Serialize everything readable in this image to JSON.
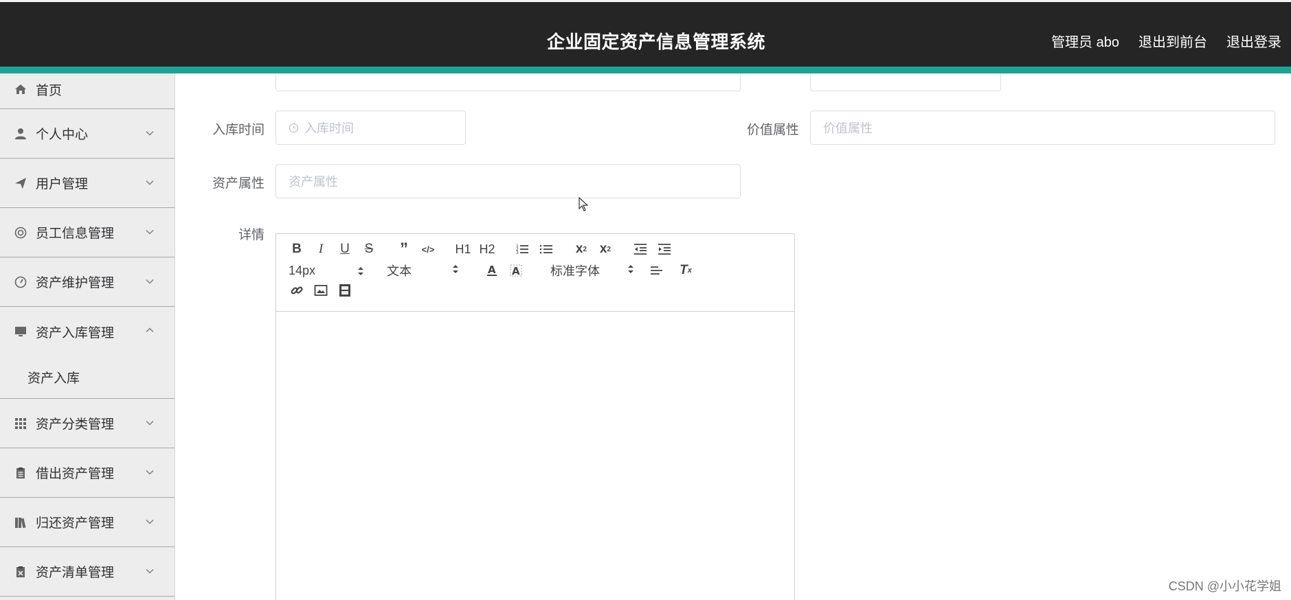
{
  "header": {
    "title": "企业固定资产信息管理系统",
    "user_label": "管理员 abo",
    "to_front_label": "退出到前台",
    "logout_label": "退出登录",
    "bg_color": "#252525",
    "accent_color": "#1aa497"
  },
  "sidebar": {
    "items": [
      {
        "label": "首页",
        "icon": "home-icon"
      },
      {
        "label": "个人中心",
        "icon": "person-icon"
      },
      {
        "label": "用户管理",
        "icon": "paper-plane-icon"
      },
      {
        "label": "员工信息管理",
        "icon": "lifebuoy-icon"
      },
      {
        "label": "资产维护管理",
        "icon": "gauge-icon"
      },
      {
        "label": "资产入库管理",
        "icon": "monitor-icon",
        "expanded": true,
        "children": [
          "资产入库"
        ]
      },
      {
        "label": "资产分类管理",
        "icon": "grid-icon"
      },
      {
        "label": "借出资产管理",
        "icon": "clipboard-icon"
      },
      {
        "label": "归还资产管理",
        "icon": "books-icon"
      },
      {
        "label": "资产清单管理",
        "icon": "clipboard-x-icon"
      }
    ]
  },
  "form": {
    "storage_time": {
      "label": "入库时间",
      "placeholder": "入库时间"
    },
    "value_attr": {
      "label": "价值属性",
      "placeholder": "价值属性"
    },
    "asset_attr": {
      "label": "资产属性",
      "placeholder": "资产属性"
    },
    "detail": {
      "label": "详情"
    }
  },
  "editor": {
    "font_size": "14px",
    "paragraph": "文本",
    "font_family": "标准字体",
    "h1": "H1",
    "h2": "H2"
  },
  "watermark": "CSDN @小小花学姐"
}
